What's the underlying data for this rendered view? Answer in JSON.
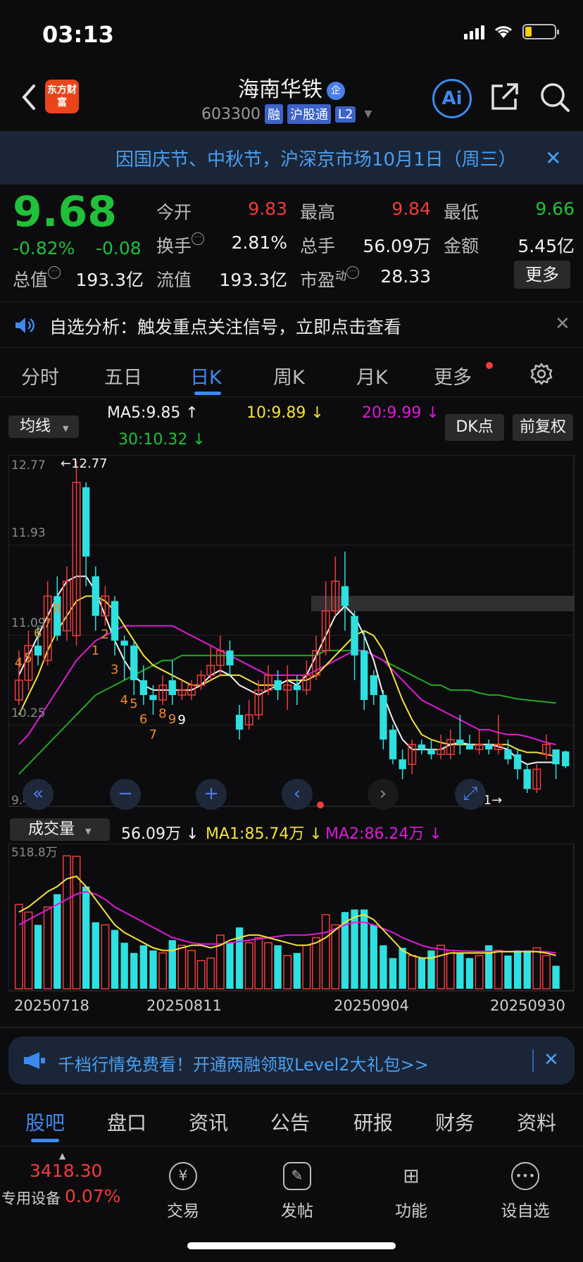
{
  "status": {
    "time": "03:13"
  },
  "header": {
    "brand": "东方财富",
    "stock_name": "海南华铁",
    "qi_badge": "企",
    "stock_code": "603300",
    "tags": [
      "融",
      "沪股通",
      "L2"
    ],
    "ai_label": "Ai"
  },
  "notice": {
    "text": "因国庆节、中秋节，沪深京市场10月1日（周三）",
    "close": "✕"
  },
  "quote": {
    "price": "9.68",
    "change_pct": "-0.82%",
    "change_abs": "-0.08",
    "open_label": "今开",
    "open": "9.83",
    "high_label": "最高",
    "high": "9.84",
    "low_label": "最低",
    "low": "9.66",
    "turnover_label": "换手",
    "turnover": "2.81%",
    "volume_label": "总手",
    "volume": "56.09万",
    "amount_label": "金额",
    "amount": "5.45亿",
    "mktcap_label": "总值",
    "mktcap": "193.3亿",
    "float_label": "流值",
    "float": "193.3亿",
    "pe_label": "市盈",
    "pe_sup": "动",
    "pe": "28.33",
    "more_label": "更多"
  },
  "analysis": {
    "text": "自选分析：触发重点关注信号，立即点击查看",
    "close": "✕"
  },
  "period_tabs": [
    "分时",
    "五日",
    "日K",
    "周K",
    "月K",
    "更多"
  ],
  "ma_row": {
    "select": "均线",
    "ma5": "MA5:9.85",
    "ma10": "10:9.89",
    "ma20": "20:9.99",
    "ma30": "30:10.32",
    "dk": "DK点",
    "fq": "前复权"
  },
  "chart_axis": {
    "y_labels": [
      "12.77",
      "11.93",
      "11.09",
      "10.25",
      "9.41"
    ],
    "max_label": "←12.77",
    "min_label": "9.41→"
  },
  "volume_header": {
    "select": "成交量",
    "vol": "56.09万",
    "ma1": "MA1:85.74万",
    "ma2": "MA2:86.24万",
    "max_label": "518.8万"
  },
  "x_dates": [
    "20250718",
    "20250811",
    "20250904",
    "20250930"
  ],
  "chart_data": {
    "type": "candlestick",
    "ylim": [
      9.41,
      12.77
    ],
    "candles": [
      {
        "o": 10.35,
        "c": 10.55,
        "h": 10.85,
        "l": 10.3
      },
      {
        "o": 10.55,
        "c": 10.9,
        "h": 11.05,
        "l": 10.45
      },
      {
        "o": 10.9,
        "c": 10.8,
        "h": 11.1,
        "l": 10.7
      },
      {
        "o": 10.75,
        "c": 11.4,
        "h": 11.55,
        "l": 10.7
      },
      {
        "o": 11.4,
        "c": 11.0,
        "h": 11.6,
        "l": 10.95
      },
      {
        "o": 11.05,
        "c": 11.55,
        "h": 11.7,
        "l": 10.95
      },
      {
        "o": 11.0,
        "c": 12.55,
        "h": 12.77,
        "l": 10.9
      },
      {
        "o": 12.5,
        "c": 11.8,
        "h": 12.55,
        "l": 11.5
      },
      {
        "o": 11.6,
        "c": 11.2,
        "h": 11.7,
        "l": 11.05
      },
      {
        "o": 11.2,
        "c": 11.4,
        "h": 11.5,
        "l": 11.1
      },
      {
        "o": 11.35,
        "c": 10.95,
        "h": 11.4,
        "l": 10.8
      },
      {
        "o": 10.95,
        "c": 10.9,
        "h": 11.0,
        "l": 10.55
      },
      {
        "o": 10.9,
        "c": 10.55,
        "h": 10.95,
        "l": 10.4
      },
      {
        "o": 10.55,
        "c": 10.4,
        "h": 10.7,
        "l": 10.3
      },
      {
        "o": 10.4,
        "c": 10.35,
        "h": 10.5,
        "l": 10.2
      },
      {
        "o": 10.35,
        "c": 10.5,
        "h": 10.6,
        "l": 10.3
      },
      {
        "o": 10.55,
        "c": 10.4,
        "h": 10.75,
        "l": 10.3
      },
      {
        "o": 10.4,
        "c": 10.45,
        "h": 10.55,
        "l": 10.35
      },
      {
        "o": 10.4,
        "c": 10.5,
        "h": 10.55,
        "l": 10.35
      },
      {
        "o": 10.5,
        "c": 10.6,
        "h": 10.65,
        "l": 10.45
      },
      {
        "o": 10.6,
        "c": 10.7,
        "h": 10.9,
        "l": 10.55
      },
      {
        "o": 10.7,
        "c": 10.85,
        "h": 11.0,
        "l": 10.6
      },
      {
        "o": 10.85,
        "c": 10.7,
        "h": 10.95,
        "l": 10.6
      },
      {
        "o": 10.2,
        "c": 10.05,
        "h": 10.3,
        "l": 9.95
      },
      {
        "o": 10.1,
        "c": 10.2,
        "h": 10.35,
        "l": 10.05
      },
      {
        "o": 10.2,
        "c": 10.45,
        "h": 10.55,
        "l": 10.15
      },
      {
        "o": 10.45,
        "c": 10.6,
        "h": 10.7,
        "l": 10.4
      },
      {
        "o": 10.55,
        "c": 10.45,
        "h": 10.65,
        "l": 10.35
      },
      {
        "o": 10.45,
        "c": 10.5,
        "h": 10.7,
        "l": 10.25
      },
      {
        "o": 10.5,
        "c": 10.45,
        "h": 10.6,
        "l": 10.3
      },
      {
        "o": 10.45,
        "c": 10.6,
        "h": 10.75,
        "l": 10.4
      },
      {
        "o": 10.6,
        "c": 10.85,
        "h": 11.0,
        "l": 10.55
      },
      {
        "o": 10.85,
        "c": 11.25,
        "h": 11.55,
        "l": 10.8
      },
      {
        "o": 11.25,
        "c": 11.55,
        "h": 11.8,
        "l": 11.2
      },
      {
        "o": 11.5,
        "c": 11.3,
        "h": 11.85,
        "l": 11.05
      },
      {
        "o": 11.2,
        "c": 10.8,
        "h": 11.25,
        "l": 10.55
      },
      {
        "o": 10.85,
        "c": 10.35,
        "h": 11.05,
        "l": 10.25
      },
      {
        "o": 10.6,
        "c": 10.4,
        "h": 10.65,
        "l": 10.3
      },
      {
        "o": 10.4,
        "c": 9.95,
        "h": 10.45,
        "l": 9.85
      },
      {
        "o": 10.05,
        "c": 9.75,
        "h": 10.1,
        "l": 9.7
      },
      {
        "o": 9.75,
        "c": 9.65,
        "h": 9.85,
        "l": 9.55
      },
      {
        "o": 9.7,
        "c": 9.9,
        "h": 9.95,
        "l": 9.6
      },
      {
        "o": 9.9,
        "c": 9.85,
        "h": 9.95,
        "l": 9.8
      },
      {
        "o": 9.85,
        "c": 9.8,
        "h": 9.95,
        "l": 9.75
      },
      {
        "o": 9.8,
        "c": 9.85,
        "h": 10.0,
        "l": 9.75
      },
      {
        "o": 9.8,
        "c": 9.95,
        "h": 10.05,
        "l": 9.75
      },
      {
        "o": 9.95,
        "c": 9.9,
        "h": 10.2,
        "l": 9.8
      },
      {
        "o": 9.9,
        "c": 9.85,
        "h": 10.0,
        "l": 9.85
      },
      {
        "o": 9.85,
        "c": 9.9,
        "h": 10.05,
        "l": 9.8
      },
      {
        "o": 9.9,
        "c": 9.85,
        "h": 9.95,
        "l": 9.8
      },
      {
        "o": 9.85,
        "c": 9.9,
        "h": 10.2,
        "l": 9.8
      },
      {
        "o": 9.85,
        "c": 9.75,
        "h": 9.95,
        "l": 9.7
      },
      {
        "o": 9.8,
        "c": 9.65,
        "h": 9.85,
        "l": 9.55
      },
      {
        "o": 9.65,
        "c": 9.45,
        "h": 9.7,
        "l": 9.41
      },
      {
        "o": 9.45,
        "c": 9.65,
        "h": 9.7,
        "l": 9.41
      },
      {
        "o": 9.8,
        "c": 9.9,
        "h": 10.0,
        "l": 9.75
      },
      {
        "o": 9.85,
        "c": 9.7,
        "h": 9.85,
        "l": 9.55
      },
      {
        "o": 9.83,
        "c": 9.68,
        "h": 9.84,
        "l": 9.66
      }
    ],
    "ma5": [
      10.6,
      10.8,
      11.0,
      11.2,
      11.4,
      11.55,
      11.6,
      11.6,
      11.45,
      11.2,
      10.95,
      10.75,
      10.6,
      10.5,
      10.45,
      10.45,
      10.45,
      10.45,
      10.45,
      10.5,
      10.6,
      10.65,
      10.6,
      10.5,
      10.45,
      10.4,
      10.45,
      10.5,
      10.55,
      10.5,
      10.6,
      10.8,
      11.0,
      11.2,
      11.3,
      11.2,
      11.0,
      10.75,
      10.4,
      10.15,
      9.95,
      9.85,
      9.85,
      9.85,
      9.85,
      9.9,
      9.92,
      9.9,
      9.9,
      9.9,
      9.88,
      9.85,
      9.75,
      9.7,
      9.72,
      9.72,
      9.72
    ],
    "ma10": [
      10.2,
      10.4,
      10.6,
      10.85,
      11.05,
      11.2,
      11.35,
      11.4,
      11.4,
      11.35,
      11.25,
      11.1,
      10.95,
      10.8,
      10.7,
      10.65,
      10.6,
      10.55,
      10.5,
      10.5,
      10.55,
      10.6,
      10.6,
      10.6,
      10.55,
      10.5,
      10.5,
      10.5,
      10.55,
      10.55,
      10.55,
      10.6,
      10.7,
      10.8,
      10.9,
      11.0,
      11.05,
      11.0,
      10.85,
      10.6,
      10.35,
      10.15,
      10.0,
      9.95,
      9.92,
      9.9,
      9.9,
      9.9,
      9.9,
      9.9,
      9.9,
      9.9,
      9.85,
      9.82,
      9.82,
      9.8,
      9.78
    ],
    "ma20": [
      9.9,
      10.0,
      10.15,
      10.3,
      10.45,
      10.6,
      10.75,
      10.85,
      10.95,
      11.0,
      11.05,
      11.1,
      11.1,
      11.1,
      11.1,
      11.1,
      11.1,
      11.05,
      11.0,
      10.95,
      10.9,
      10.85,
      10.8,
      10.75,
      10.7,
      10.65,
      10.6,
      10.6,
      10.6,
      10.6,
      10.6,
      10.65,
      10.7,
      10.75,
      10.8,
      10.85,
      10.85,
      10.8,
      10.75,
      10.65,
      10.55,
      10.45,
      10.35,
      10.3,
      10.25,
      10.2,
      10.15,
      10.1,
      10.05,
      10.05,
      10.02,
      10.0,
      10.0,
      9.98,
      9.95,
      9.92,
      9.9
    ],
    "ma30": [
      9.6,
      9.7,
      9.8,
      9.9,
      10.0,
      10.1,
      10.2,
      10.3,
      10.4,
      10.45,
      10.5,
      10.55,
      10.6,
      10.65,
      10.7,
      10.75,
      10.75,
      10.8,
      10.8,
      10.8,
      10.8,
      10.8,
      10.8,
      10.8,
      10.8,
      10.8,
      10.8,
      10.8,
      10.8,
      10.8,
      10.8,
      10.8,
      10.85,
      10.85,
      10.85,
      10.85,
      10.85,
      10.8,
      10.75,
      10.7,
      10.65,
      10.6,
      10.55,
      10.5,
      10.5,
      10.45,
      10.45,
      10.45,
      10.42,
      10.4,
      10.4,
      10.38,
      10.36,
      10.35,
      10.34,
      10.33,
      10.32
    ],
    "volume": [
      330,
      300,
      250,
      320,
      370,
      520,
      518,
      400,
      260,
      250,
      230,
      180,
      140,
      170,
      150,
      140,
      190,
      170,
      150,
      110,
      120,
      210,
      180,
      240,
      180,
      200,
      180,
      170,
      130,
      140,
      170,
      200,
      290,
      250,
      300,
      310,
      310,
      250,
      170,
      120,
      160,
      130,
      120,
      150,
      170,
      150,
      140,
      120,
      130,
      170,
      150,
      130,
      150,
      150,
      160,
      130,
      90
    ],
    "vol_ma1": [
      300,
      320,
      350,
      380,
      400,
      430,
      440,
      400,
      350,
      300,
      250,
      220,
      200,
      180,
      160,
      150,
      150,
      160,
      170,
      170,
      160,
      170,
      190,
      200,
      210,
      210,
      200,
      190,
      180,
      170,
      170,
      180,
      200,
      230,
      260,
      280,
      290,
      270,
      230,
      190,
      150,
      130,
      120,
      120,
      130,
      140,
      140,
      140,
      140,
      140,
      145,
      145,
      145,
      145,
      145,
      140,
      130
    ],
    "vol_ma2": [
      250,
      270,
      290,
      310,
      330,
      350,
      370,
      380,
      370,
      350,
      320,
      300,
      280,
      260,
      240,
      220,
      200,
      190,
      180,
      175,
      175,
      175,
      180,
      185,
      190,
      195,
      200,
      205,
      210,
      210,
      210,
      215,
      220,
      235,
      250,
      260,
      260,
      250,
      235,
      220,
      200,
      185,
      170,
      160,
      155,
      150,
      148,
      147,
      146,
      146,
      146,
      146,
      146,
      146,
      146,
      145,
      140
    ],
    "signals_top": [
      "5",
      "4",
      "6",
      "7",
      "8",
      "1",
      "2",
      "3",
      "4",
      "5",
      "6",
      "7",
      "8",
      "9",
      "9"
    ]
  },
  "promo": {
    "text": "千档行情免费看！开通两融领取Level2大礼包>>",
    "close": "✕"
  },
  "bottom_tabs": [
    "股吧",
    "盘口",
    "资讯",
    "公告",
    "研报",
    "财务",
    "资料"
  ],
  "toolbar": {
    "index_value": "3418.30",
    "index_name": "专用设备",
    "index_pct": "0.07%",
    "items": [
      "交易",
      "发帖",
      "功能",
      "设自选"
    ]
  }
}
